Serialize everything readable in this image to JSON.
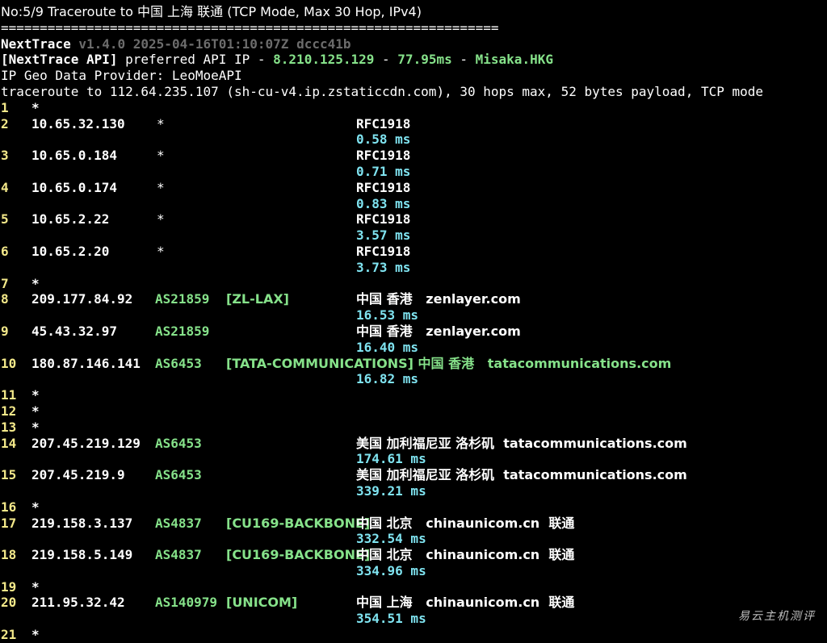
{
  "header": {
    "title_line": "No:5/9 Traceroute to 中国 上海 联通 (TCP Mode, Max 30 Hop, IPv4)",
    "separator": "================================================================"
  },
  "nexttrace": {
    "name": "NextTrace",
    "meta": "v1.4.0 2025-04-16T01:10:07Z dccc41b",
    "api_label": "[NextTrace API]",
    "api_text": " preferred API IP - ",
    "api_ip": "8.210.125.129",
    "api_dash": " - ",
    "api_latency": "77.95ms",
    "api_dash2": " - ",
    "api_node": "Misaka.HKG",
    "geo_provider": "IP Geo Data Provider: LeoMoeAPI",
    "traceroute_line": "traceroute to 112.64.235.107 (sh-cu-v4.ip.zstaticcdn.com), 30 hops max, 52 bytes payload, TCP mode"
  },
  "hops": [
    {
      "no": "1",
      "star": "*"
    },
    {
      "no": "2",
      "ip": "10.65.32.130",
      "asn_star": "*",
      "geo": "RFC1918",
      "latency": "0.58 ms"
    },
    {
      "no": "3",
      "ip": "10.65.0.184",
      "asn_star": "*",
      "geo": "RFC1918",
      "latency": "0.71 ms"
    },
    {
      "no": "4",
      "ip": "10.65.0.174",
      "asn_star": "*",
      "geo": "RFC1918",
      "latency": "0.83 ms"
    },
    {
      "no": "5",
      "ip": "10.65.2.22",
      "asn_star": "*",
      "geo": "RFC1918",
      "latency": "3.57 ms"
    },
    {
      "no": "6",
      "ip": "10.65.2.20",
      "asn_star": "*",
      "geo": "RFC1918",
      "latency": "3.73 ms"
    },
    {
      "no": "7",
      "star": "*"
    },
    {
      "no": "8",
      "ip": "209.177.84.92",
      "asn": "AS21859",
      "tag": "[ZL-LAX]",
      "geo": "中国 香港   zenlayer.com",
      "latency": "16.53 ms"
    },
    {
      "no": "9",
      "ip": "45.43.32.97",
      "asn": "AS21859",
      "geo": "中国 香港   zenlayer.com",
      "latency": "16.40 ms"
    },
    {
      "no": "10",
      "ip": "180.87.146.141",
      "asn": "AS6453",
      "tag": "[TATA-COMMUNICATIONS] 中国 香港   tatacommunications.com",
      "latency": "16.82 ms"
    },
    {
      "no": "11",
      "star": "*"
    },
    {
      "no": "12",
      "star": "*"
    },
    {
      "no": "13",
      "star": "*"
    },
    {
      "no": "14",
      "ip": "207.45.219.129",
      "asn": "AS6453",
      "geo": "美国 加利福尼亚 洛杉矶  tatacommunications.com",
      "latency": "174.61 ms"
    },
    {
      "no": "15",
      "ip": "207.45.219.9",
      "asn": "AS6453",
      "geo": "美国 加利福尼亚 洛杉矶  tatacommunications.com",
      "latency": "339.21 ms"
    },
    {
      "no": "16",
      "star": "*"
    },
    {
      "no": "17",
      "ip": "219.158.3.137",
      "asn": "AS4837",
      "tag": "[CU169-BACKBONE]",
      "geo": "中国 北京   chinaunicom.cn  联通",
      "latency": "332.54 ms"
    },
    {
      "no": "18",
      "ip": "219.158.5.149",
      "asn": "AS4837",
      "tag": "[CU169-BACKBONE]",
      "geo": "中国 北京   chinaunicom.cn  联通",
      "latency": "334.96 ms"
    },
    {
      "no": "19",
      "star": "*"
    },
    {
      "no": "20",
      "ip": "211.95.32.42",
      "asn": "AS140979",
      "tag": "[UNICOM]",
      "geo": "中国 上海   chinaunicom.cn  联通",
      "latency": "354.51 ms"
    },
    {
      "no": "21",
      "star": "*"
    }
  ],
  "watermark": "易云主机测评",
  "colors": {
    "background": "#000000",
    "hop_number": "#f4e98a",
    "asn": "#86e28a",
    "latency": "#7fe3f0",
    "meta": "#6c6c6c"
  }
}
